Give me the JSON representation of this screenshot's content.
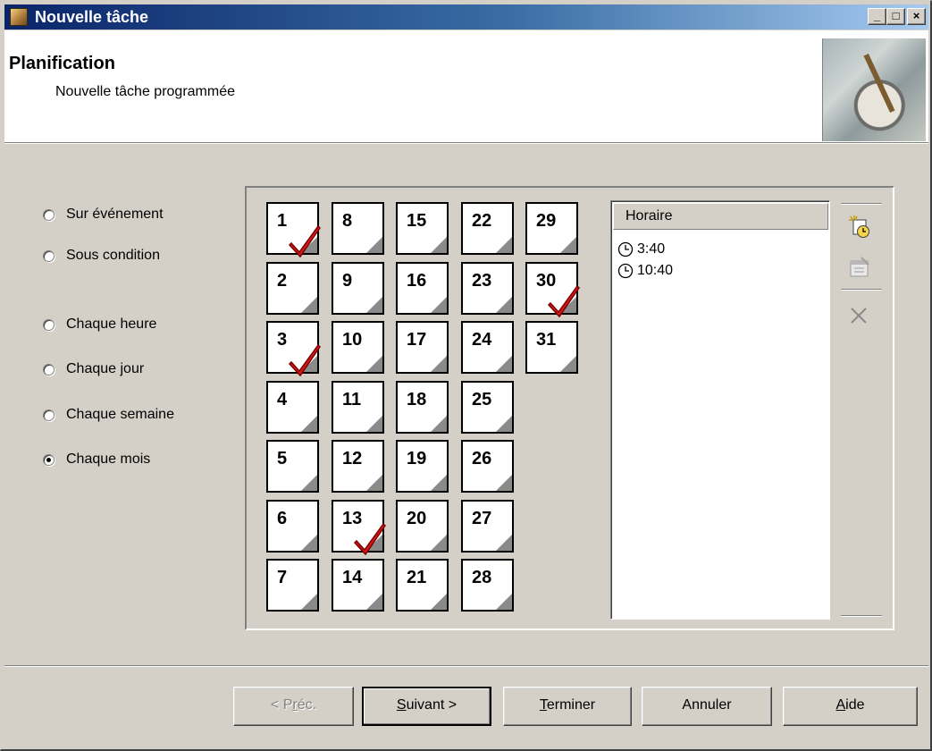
{
  "window": {
    "title": "Nouvelle tâche",
    "minimize": "_",
    "maximize": "□",
    "close": "×"
  },
  "header": {
    "title": "Planification",
    "subtitle": "Nouvelle tâche programmée"
  },
  "schedule_options": [
    {
      "label": "Sur événement",
      "selected": false
    },
    {
      "label": "Sous condition",
      "selected": false
    },
    {
      "label": "Chaque heure",
      "selected": false
    },
    {
      "label": "Chaque jour",
      "selected": false
    },
    {
      "label": "Chaque semaine",
      "selected": false
    },
    {
      "label": "Chaque mois",
      "selected": true
    }
  ],
  "calendar": {
    "days": [
      "1",
      "2",
      "3",
      "4",
      "5",
      "6",
      "7",
      "8",
      "9",
      "10",
      "11",
      "12",
      "13",
      "14",
      "15",
      "16",
      "17",
      "18",
      "19",
      "20",
      "21",
      "22",
      "23",
      "24",
      "25",
      "26",
      "27",
      "28",
      "29",
      "30",
      "31"
    ],
    "checked_days": [
      "1",
      "3",
      "13",
      "30"
    ]
  },
  "horaire_list": {
    "header": "Horaire",
    "rows": [
      "3:40",
      "10:40"
    ]
  },
  "toolbar_icons": [
    "new-schedule-icon",
    "properties-icon",
    "delete-icon"
  ],
  "buttons": {
    "prev": {
      "pre": "< P",
      "mn": "r",
      "post": "éc."
    },
    "next": {
      "pre": "",
      "mn": "S",
      "post": "uivant >"
    },
    "finish": {
      "pre": "",
      "mn": "T",
      "post": "erminer"
    },
    "cancel": "Annuler",
    "help": {
      "pre": "",
      "mn": "A",
      "post": "ide"
    }
  }
}
